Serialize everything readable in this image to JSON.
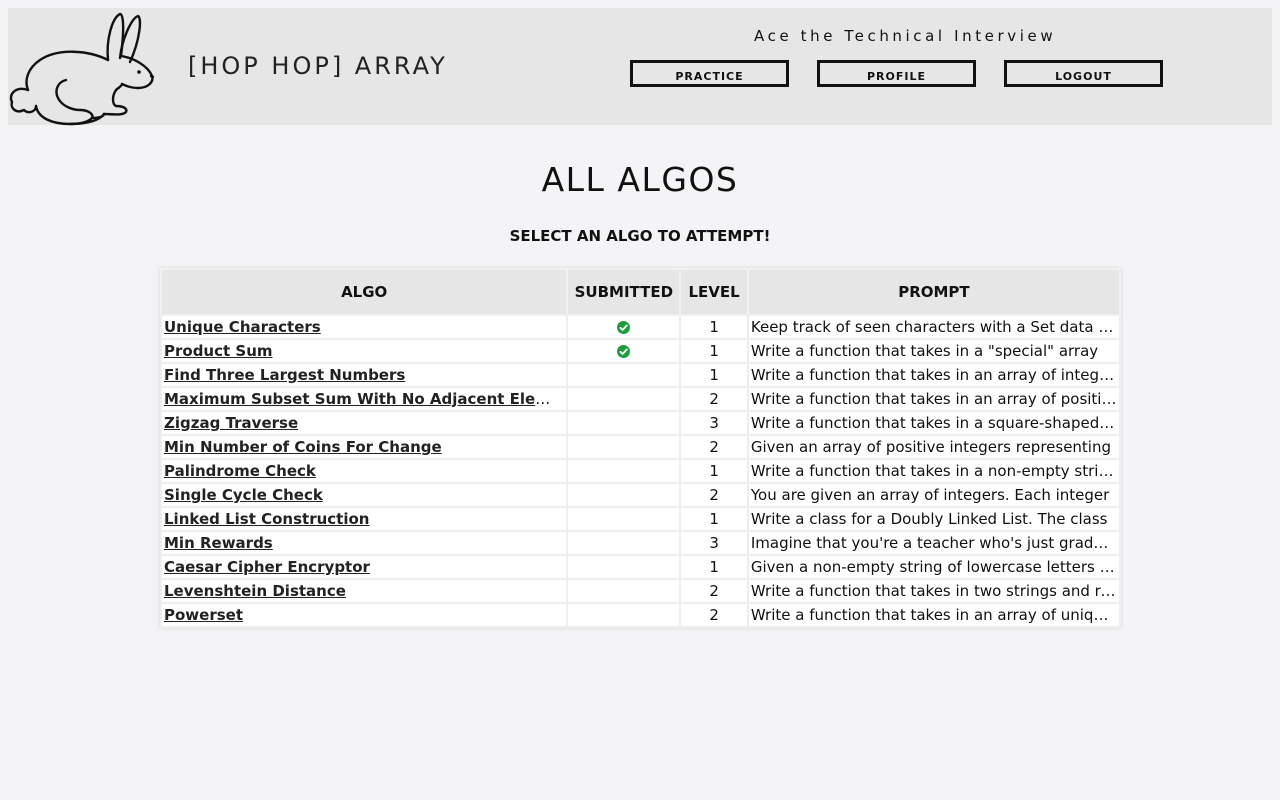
{
  "header": {
    "brand": "[HOP HOP] ARRAY",
    "tagline": "Ace the Technical Interview",
    "nav": {
      "practice": "PRACTICE",
      "profile": "PROFILE",
      "logout": "LOGOUT"
    }
  },
  "main": {
    "title": "ALL ALGOS",
    "subtitle": "SELECT AN ALGO TO ATTEMPT!",
    "columns": [
      "ALGO",
      "SUBMITTED",
      "LEVEL",
      "PROMPT"
    ],
    "rows": [
      {
        "name": "Unique Characters",
        "submitted": true,
        "level": "1",
        "prompt": "Keep track of seen characters with a Set data structure"
      },
      {
        "name": "Product Sum",
        "submitted": true,
        "level": "1",
        "prompt": "Write a function that takes in a \"special\" array"
      },
      {
        "name": "Find Three Largest Numbers",
        "submitted": false,
        "level": "1",
        "prompt": "Write a function that takes in an array of integers"
      },
      {
        "name": "Maximum Subset Sum With No Adjacent Elements",
        "submitted": false,
        "level": "2",
        "prompt": "Write a function that takes in an array of positive integers"
      },
      {
        "name": "Zigzag Traverse",
        "submitted": false,
        "level": "3",
        "prompt": "Write a function that takes in a square-shaped(n x n)"
      },
      {
        "name": "Min Number of Coins For Change",
        "submitted": false,
        "level": "2",
        "prompt": "Given an array of positive integers representing"
      },
      {
        "name": "Palindrome Check",
        "submitted": false,
        "level": "1",
        "prompt": "Write a function that takes in a non-empty string"
      },
      {
        "name": "Single Cycle Check",
        "submitted": false,
        "level": "2",
        "prompt": "You are given an array of integers. Each integer"
      },
      {
        "name": "Linked List Construction",
        "submitted": false,
        "level": "1",
        "prompt": "Write a class for a Doubly Linked List. The class"
      },
      {
        "name": "Min Rewards",
        "submitted": false,
        "level": "3",
        "prompt": "Imagine that you're a teacher who's just graded the final exam"
      },
      {
        "name": "Caesar Cipher Encryptor",
        "submitted": false,
        "level": "1",
        "prompt": "Given a non-empty string of lowercase letters and"
      },
      {
        "name": "Levenshtein Distance",
        "submitted": false,
        "level": "2",
        "prompt": "Write a function that takes in two strings and returns"
      },
      {
        "name": "Powerset",
        "submitted": false,
        "level": "2",
        "prompt": "Write a function that takes in an array of unique integers"
      }
    ]
  },
  "colors": {
    "header_bg": "#e6e6e6",
    "page_bg": "#f4f4f6",
    "check_green": "#1e9e3a"
  }
}
